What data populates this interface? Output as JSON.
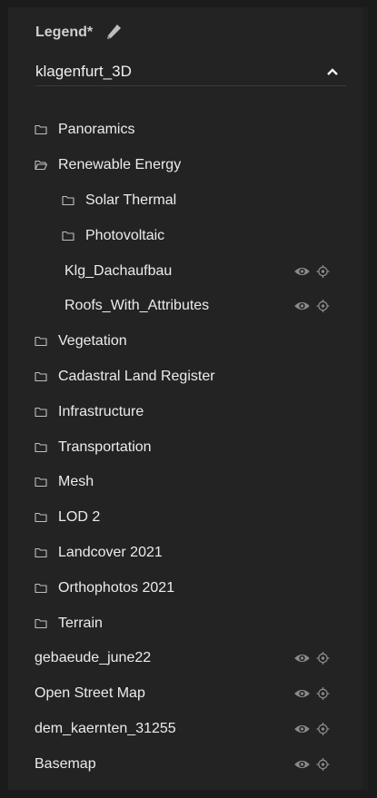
{
  "header": {
    "title": "Legend*",
    "edit_icon": "pencil-icon"
  },
  "project": {
    "name": "klagenfurt_3D",
    "toggle_icon": "chevron-up-icon"
  },
  "tree": [
    {
      "label": "Panoramics",
      "type": "folder",
      "level": 0,
      "open": false
    },
    {
      "label": "Renewable Energy",
      "type": "folder",
      "level": 0,
      "open": true
    },
    {
      "label": "Solar Thermal",
      "type": "folder",
      "level": 1,
      "open": false
    },
    {
      "label": "Photovoltaic",
      "type": "folder",
      "level": 1,
      "open": false
    },
    {
      "label": "Klg_Dachaufbau",
      "type": "layer",
      "level": 1
    },
    {
      "label": "Roofs_With_Attributes",
      "type": "layer",
      "level": 1
    },
    {
      "label": "Vegetation",
      "type": "folder",
      "level": 0,
      "open": false
    },
    {
      "label": "Cadastral Land Register",
      "type": "folder",
      "level": 0,
      "open": false
    },
    {
      "label": "Infrastructure",
      "type": "folder",
      "level": 0,
      "open": false
    },
    {
      "label": "Transportation",
      "type": "folder",
      "level": 0,
      "open": false
    },
    {
      "label": "Mesh",
      "type": "folder",
      "level": 0,
      "open": false
    },
    {
      "label": "LOD 2",
      "type": "folder",
      "level": 0,
      "open": false
    },
    {
      "label": "Landcover 2021",
      "type": "folder",
      "level": 0,
      "open": false
    },
    {
      "label": "Orthophotos 2021",
      "type": "folder",
      "level": 0,
      "open": false
    },
    {
      "label": "Terrain",
      "type": "folder",
      "level": 0,
      "open": false
    },
    {
      "label": "gebaeude_june22",
      "type": "layer",
      "level": 0
    },
    {
      "label": "Open Street Map",
      "type": "layer",
      "level": 0
    },
    {
      "label": "dem_kaernten_31255",
      "type": "layer",
      "level": 0
    },
    {
      "label": "Basemap",
      "type": "layer",
      "level": 0
    }
  ],
  "icons": {
    "folder_closed": "folder-icon",
    "folder_open": "folder-open-icon",
    "visibility": "eye-icon",
    "zoom_to": "crosshair-icon"
  },
  "colors": {
    "panel_bg": "#232323",
    "text": "#ececec",
    "icon": "#8a8a8a"
  }
}
